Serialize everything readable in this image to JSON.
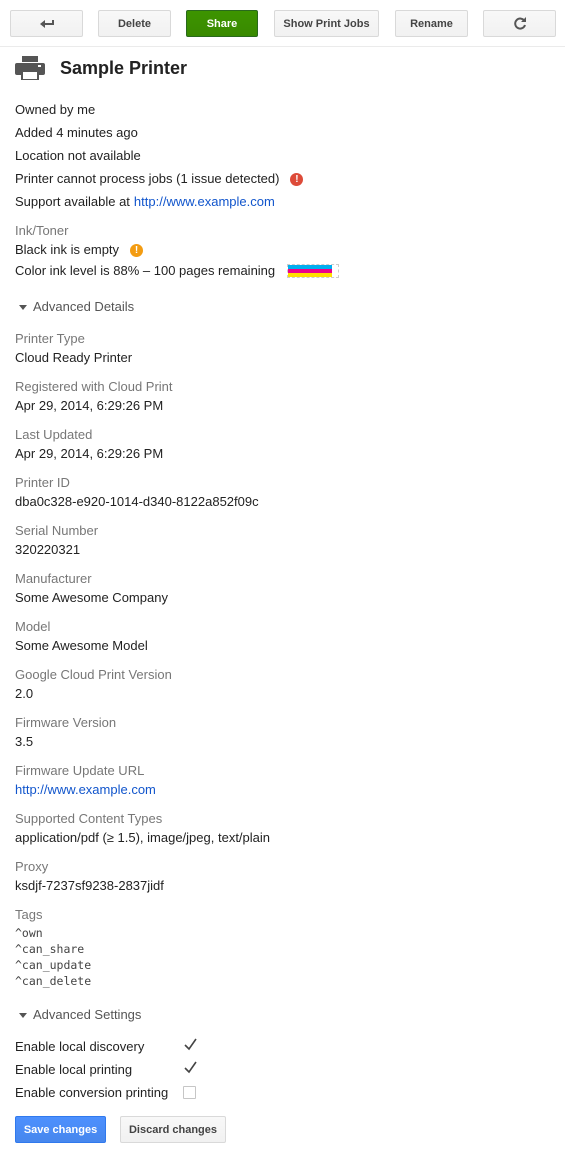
{
  "toolbar": {
    "back_icon": "back-arrow-icon",
    "delete_label": "Delete",
    "share_label": "Share",
    "show_jobs_label": "Show Print Jobs",
    "rename_label": "Rename",
    "refresh_icon": "refresh-icon"
  },
  "printer": {
    "icon": "printer-icon",
    "name": "Sample Printer"
  },
  "status": {
    "owned": "Owned by me",
    "added": "Added 4 minutes ago",
    "location": "Location not available",
    "jobs": "Printer cannot process jobs (1 issue detected)",
    "support_prefix": "Support available at",
    "support_link": "http://www.example.com"
  },
  "ink": {
    "label": "Ink/Toner",
    "black": "Black ink is empty",
    "color": "Color ink level is 88% – 100 pages remaining",
    "color_level": 0.88,
    "colors": [
      "#00aeef",
      "#ec008c",
      "#ffde00"
    ]
  },
  "advanced_details": {
    "toggle_label": "Advanced Details",
    "fields": [
      {
        "label": "Printer Type",
        "value": "Cloud Ready Printer"
      },
      {
        "label": "Registered with Cloud Print",
        "value": "Apr 29, 2014, 6:29:26 PM"
      },
      {
        "label": "Last Updated",
        "value": "Apr 29, 2014, 6:29:26 PM"
      },
      {
        "label": "Printer ID",
        "value": "dba0c328-e920-1014-d340-8122a852f09c"
      },
      {
        "label": "Serial Number",
        "value": "320220321"
      },
      {
        "label": "Manufacturer",
        "value": "Some Awesome Company"
      },
      {
        "label": "Model",
        "value": "Some Awesome Model"
      },
      {
        "label": "Google Cloud Print Version",
        "value": "2.0"
      },
      {
        "label": "Firmware Version",
        "value": "3.5"
      },
      {
        "label": "Firmware Update URL",
        "value": "http://www.example.com"
      },
      {
        "label": "Supported Content Types",
        "value": "application/pdf (≥ 1.5), image/jpeg, text/plain"
      },
      {
        "label": "Proxy",
        "value": "ksdjf-7237sf9238-2837jidf"
      }
    ],
    "tags_label": "Tags",
    "tags": [
      "^own",
      "^can_share",
      "^can_update",
      "^can_delete"
    ]
  },
  "advanced_settings": {
    "toggle_label": "Advanced Settings",
    "options": [
      {
        "label": "Enable local discovery",
        "checked": true
      },
      {
        "label": "Enable local printing",
        "checked": true
      },
      {
        "label": "Enable conversion printing",
        "checked": false
      }
    ]
  },
  "actions": {
    "save_label": "Save changes",
    "discard_label": "Discard changes"
  },
  "colors": {
    "accent_green": "#3d9400",
    "accent_blue": "#4d90fe",
    "link": "#1155cc",
    "error": "#dd4b39",
    "warning": "#f39c12"
  }
}
